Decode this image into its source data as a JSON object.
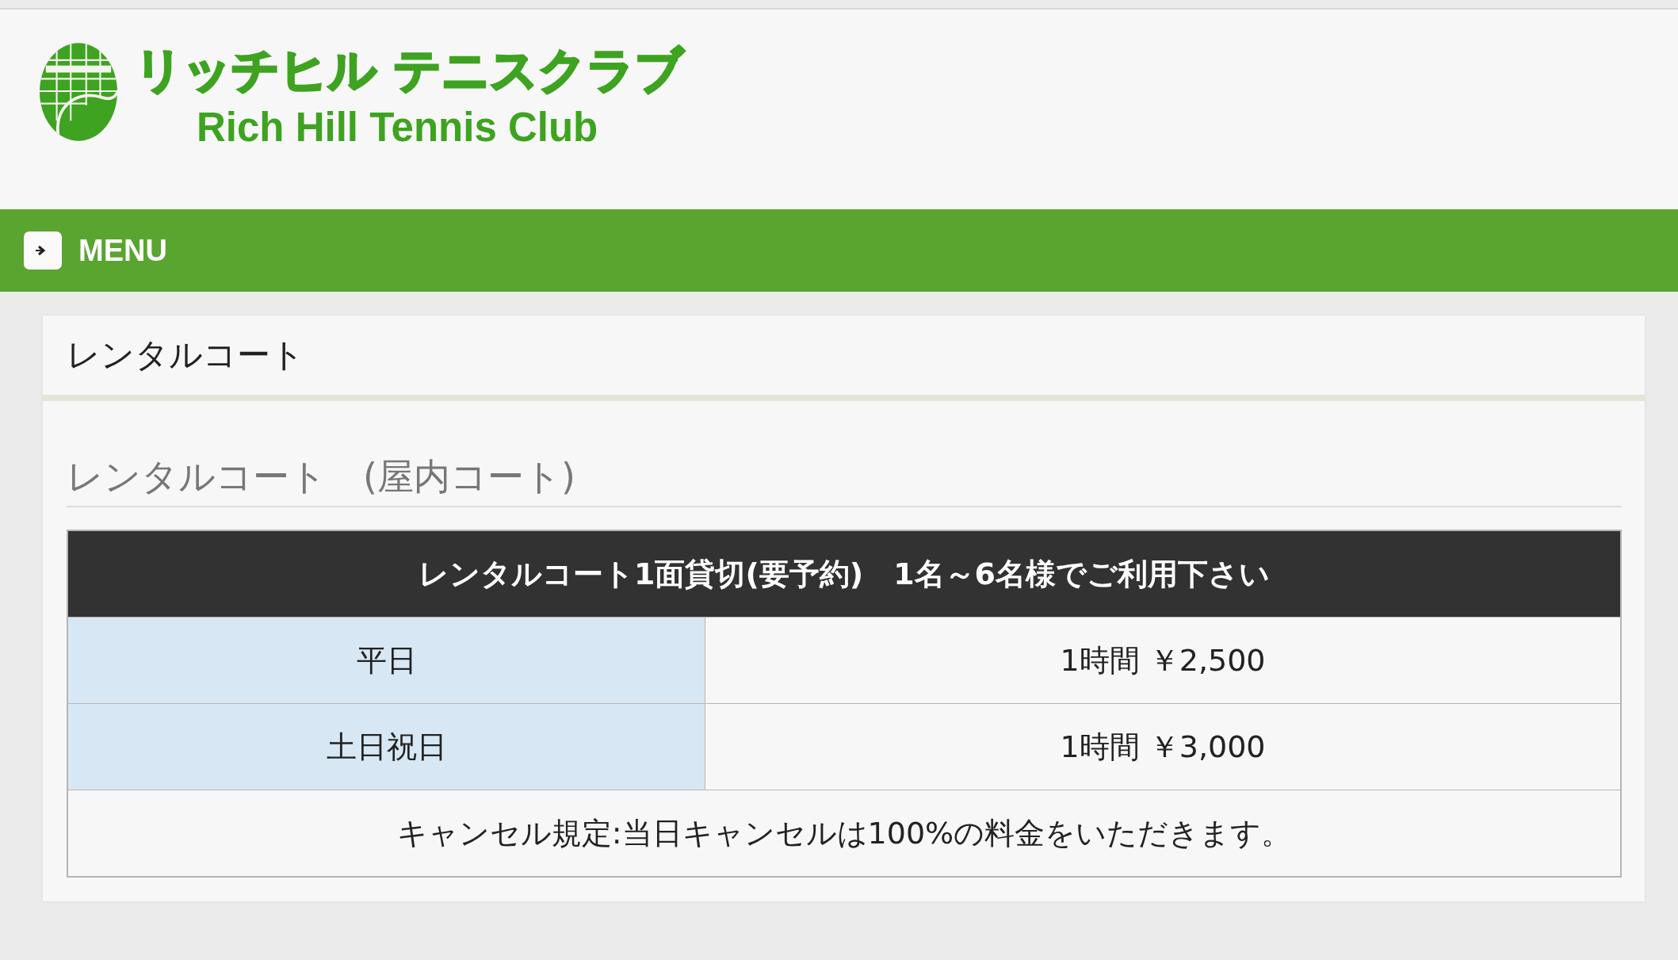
{
  "header": {
    "logo_title": "リッチヒル テニスクラブ",
    "logo_subtitle": "Rich Hill Tennis Club"
  },
  "menu_bar": {
    "label": "MENU"
  },
  "page": {
    "title": "レンタルコート",
    "section_heading": "レンタルコート　(屋内コート)",
    "table": {
      "header": "レンタルコート1面貸切(要予約)　1名～6名様でご利用下さい",
      "rows": [
        {
          "label": "平日",
          "price": "1時間 ￥2,500"
        },
        {
          "label": "土日祝日",
          "price": "1時間 ￥3,000"
        }
      ],
      "note": "キャンセル規定:当日キャンセルは100%の料金をいただきます。"
    }
  }
}
